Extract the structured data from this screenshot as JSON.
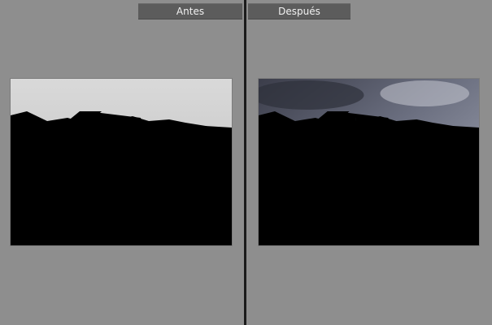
{
  "compare_view": {
    "before_label": "Antes",
    "after_label": "Después"
  },
  "colors": {
    "panel_background": "#8e8e8e",
    "label_background": "#5c5c5c",
    "label_text": "#f2f2f2"
  },
  "icons": {
    "before_photo": "church-photo",
    "after_photo": "church-photo"
  }
}
